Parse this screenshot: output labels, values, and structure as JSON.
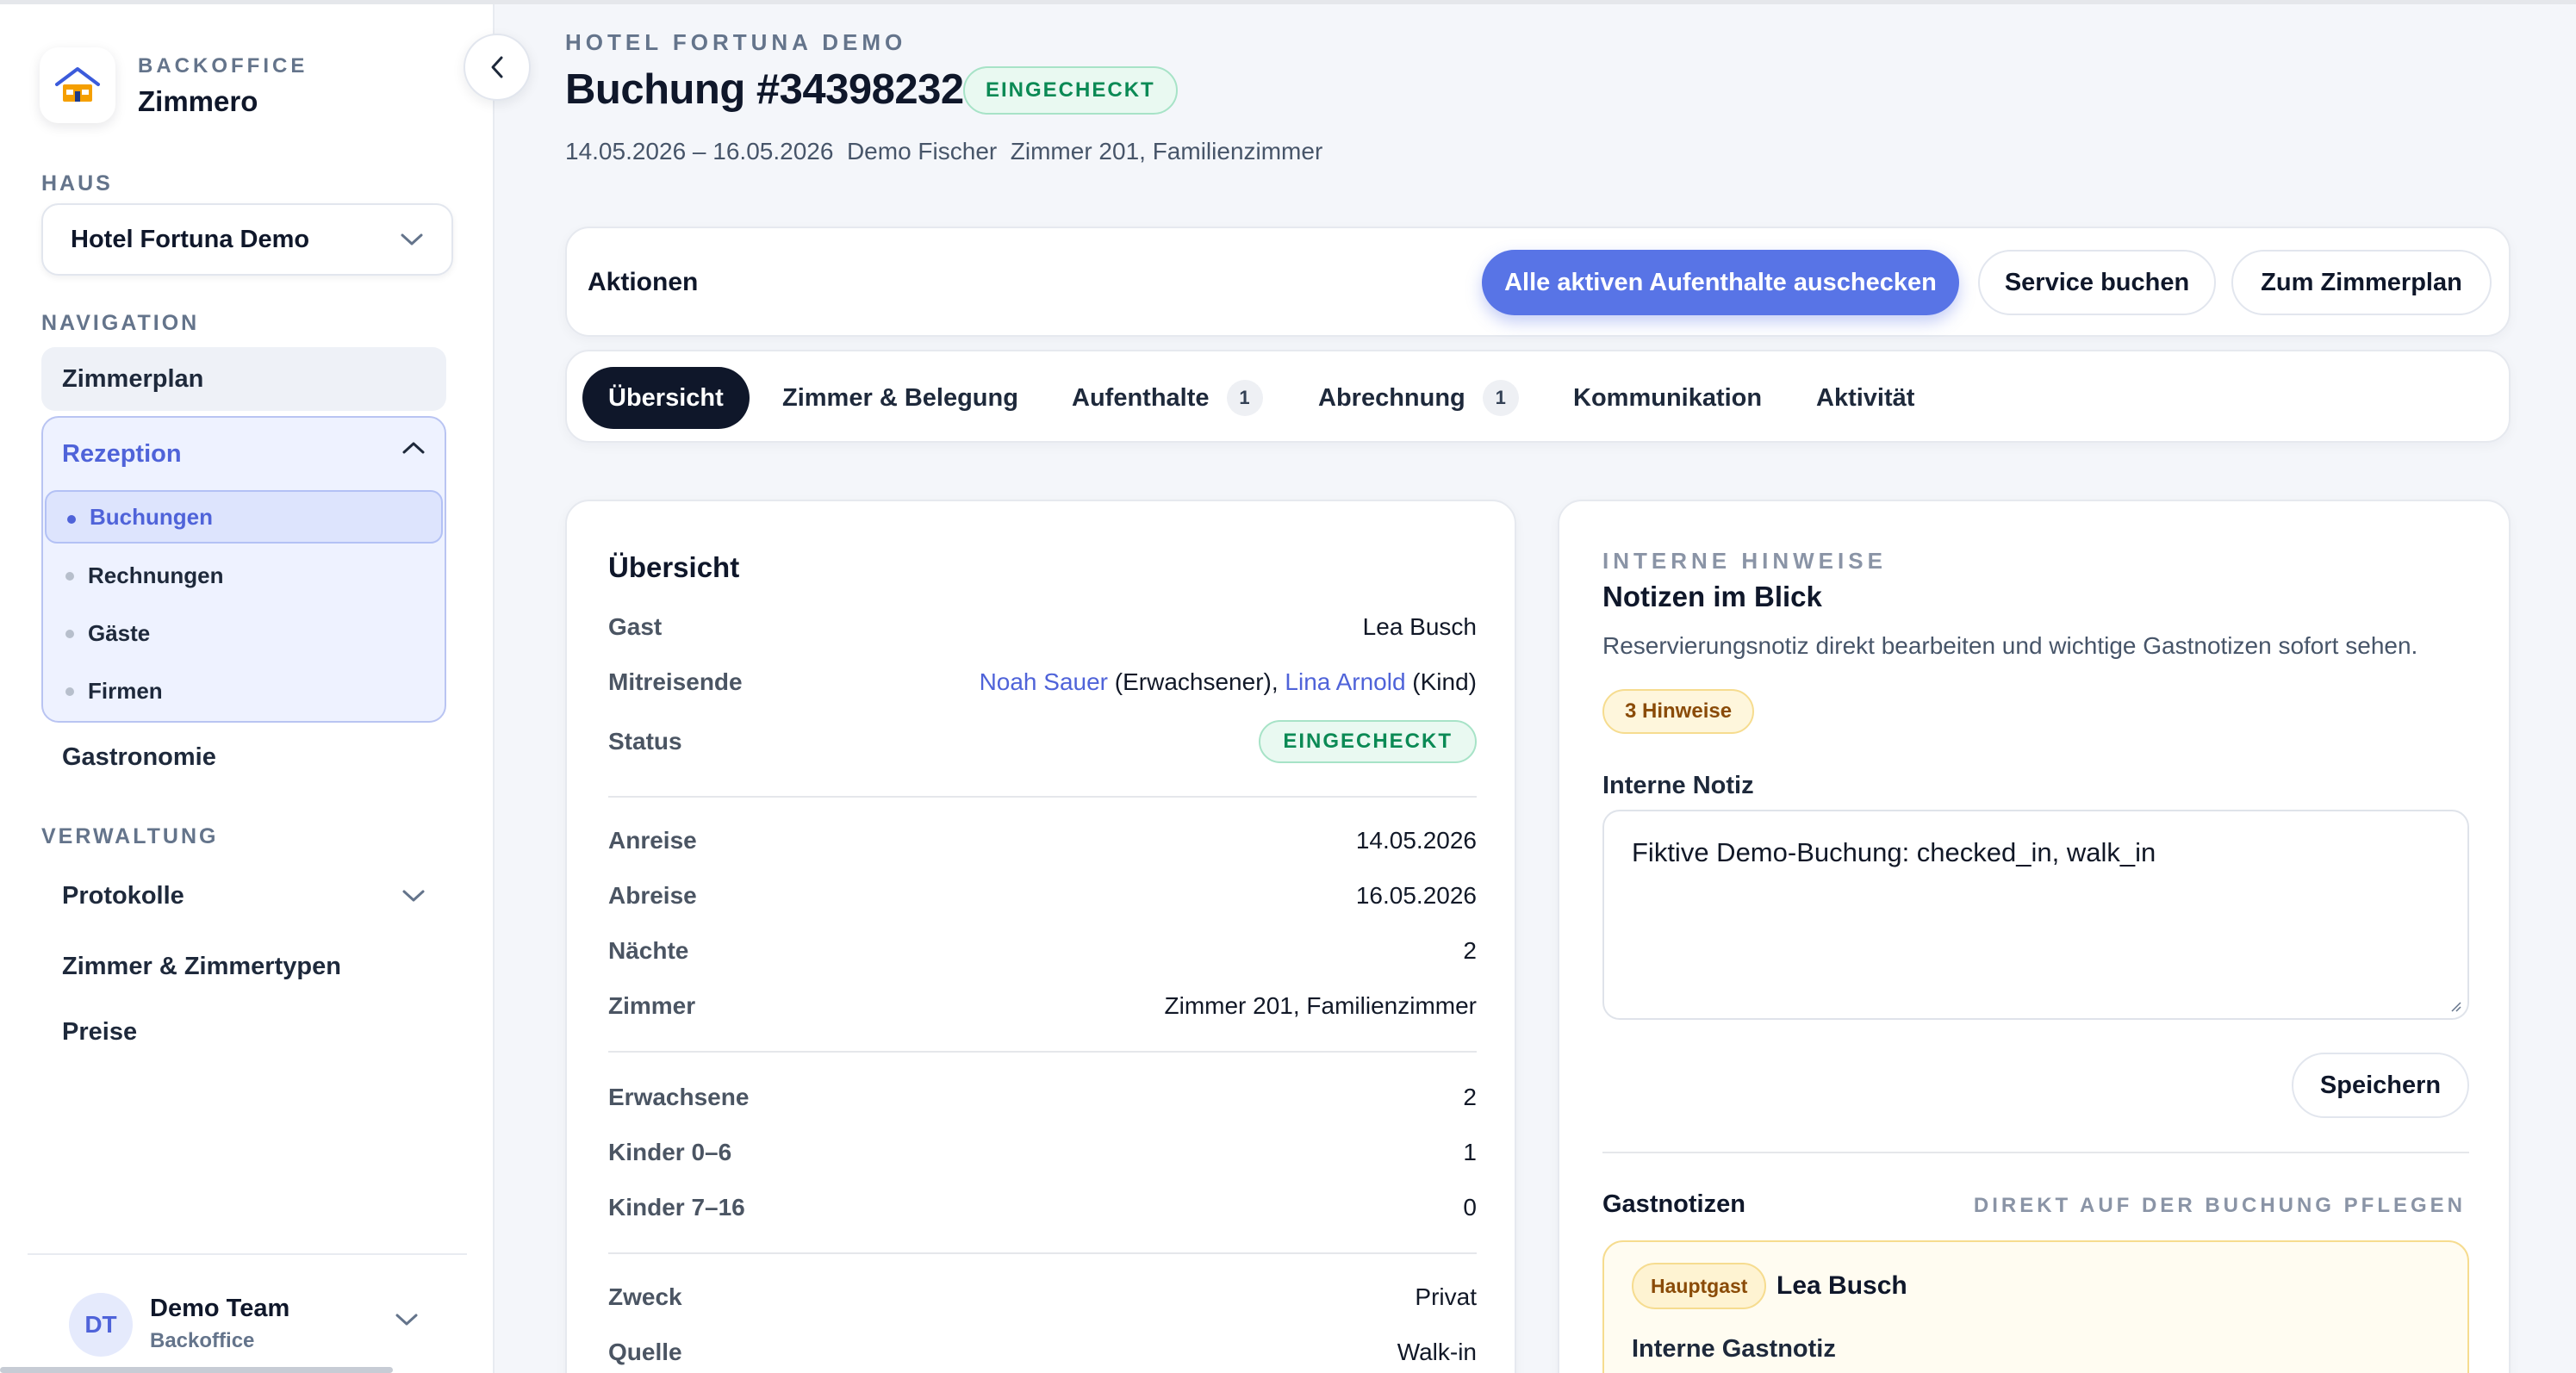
{
  "brand": {
    "eyebrow": "BACKOFFICE",
    "name": "Zimmero",
    "logo_icon": "hotel-icon"
  },
  "sidebar": {
    "house_label": "HAUS",
    "house_value": "Hotel Fortuna Demo",
    "nav_label": "NAVIGATION",
    "nav_zimmerplan": "Zimmerplan",
    "rezeption": {
      "label": "Rezeption",
      "items": [
        {
          "label": "Buchungen"
        },
        {
          "label": "Rechnungen"
        },
        {
          "label": "Gäste"
        },
        {
          "label": "Firmen"
        }
      ]
    },
    "nav_gastronomie": "Gastronomie",
    "admin_label": "VERWALTUNG",
    "admin_items": [
      {
        "label": "Protokolle"
      },
      {
        "label": "Zimmer & Zimmertypen"
      },
      {
        "label": "Preise"
      }
    ],
    "user": {
      "initials": "DT",
      "name": "Demo Team",
      "role": "Backoffice"
    }
  },
  "header": {
    "hotel": "HOTEL FORTUNA DEMO",
    "title": "Buchung #34398232",
    "status": "EINGECHECKT",
    "subline": "14.05.2026 – 16.05.2026  Demo Fischer  Zimmer 201, Familienzimmer"
  },
  "actions": {
    "label": "Aktionen",
    "checkout_all": "Alle aktiven Aufenthalte auschecken",
    "book_service": "Service buchen",
    "to_roomplan": "Zum Zimmerplan"
  },
  "tabs": [
    {
      "label": "Übersicht"
    },
    {
      "label": "Zimmer & Belegung"
    },
    {
      "label": "Aufenthalte",
      "count": "1"
    },
    {
      "label": "Abrechnung",
      "count": "1"
    },
    {
      "label": "Kommunikation"
    },
    {
      "label": "Aktivität"
    }
  ],
  "overview": {
    "title": "Übersicht",
    "guest_label": "Gast",
    "guest_value": "Lea Busch",
    "companions_label": "Mitreisende",
    "companion1_name": "Noah Sauer",
    "companion1_role": "(Erwachsener),",
    "companion2_name": "Lina Arnold",
    "companion2_role": "(Kind)",
    "status_label": "Status",
    "status_value": "EINGECHECKT",
    "rows_dates": [
      {
        "k": "Anreise",
        "v": "14.05.2026"
      },
      {
        "k": "Abreise",
        "v": "16.05.2026"
      },
      {
        "k": "Nächte",
        "v": "2"
      },
      {
        "k": "Zimmer",
        "v": "Zimmer 201, Familienzimmer"
      }
    ],
    "rows_people": [
      {
        "k": "Erwachsene",
        "v": "2"
      },
      {
        "k": "Kinder 0–6",
        "v": "1"
      },
      {
        "k": "Kinder 7–16",
        "v": "0"
      }
    ],
    "rows_meta": [
      {
        "k": "Zweck",
        "v": "Privat"
      },
      {
        "k": "Quelle",
        "v": "Walk-in"
      }
    ]
  },
  "notes": {
    "eyebrow": "INTERNE HINWEISE",
    "title": "Notizen im Blick",
    "description": "Reservierungsnotiz direkt bearbeiten und wichtige Gastnotizen sofort sehen.",
    "hint_badge": "3 Hinweise",
    "internal_label": "Interne Notiz",
    "internal_value": "Fiktive Demo-Buchung: checked_in, walk_in",
    "save": "Speichern",
    "guest_notes_label": "Gastnotizen",
    "guest_notes_link": "DIREKT AUF DER BUCHUNG PFLEGEN",
    "main_guest_badge": "Hauptgast",
    "main_guest_name": "Lea Busch",
    "guest_internal_label": "Interne Gastnotiz"
  },
  "colors": {
    "accent": "#5874e6",
    "success": "#0b8a55",
    "warning": "#8a4b08",
    "dark": "#0f172a"
  }
}
